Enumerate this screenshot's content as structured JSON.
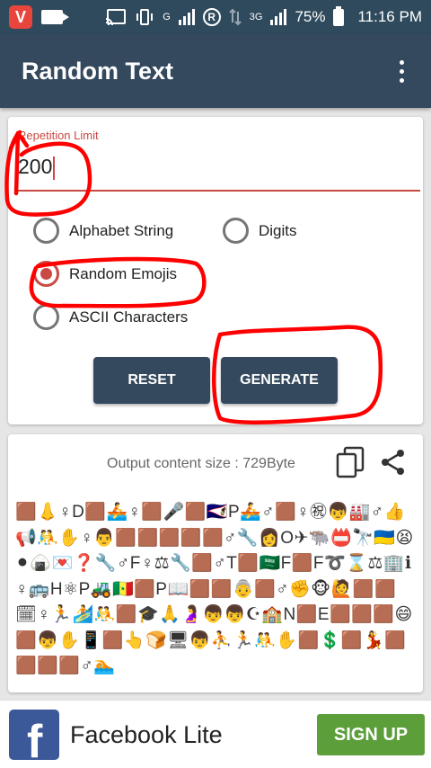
{
  "status_bar": {
    "app_badge": "V",
    "net_g": "G",
    "net_r": "R",
    "net_3g": "3G",
    "battery": "75%",
    "time": "11:16 PM"
  },
  "app_bar": {
    "title": "Random Text"
  },
  "form": {
    "label": "Repetition Limit",
    "value": "200",
    "options": [
      {
        "label": "Alphabet String",
        "checked": false
      },
      {
        "label": "Digits",
        "checked": false
      },
      {
        "label": "Random Emojis",
        "checked": true
      },
      {
        "label": "ASCII Characters",
        "checked": false
      }
    ],
    "reset_label": "RESET",
    "generate_label": "GENERATE"
  },
  "output": {
    "size_label": "Output content size : 729Byte",
    "content": "🟫👃♀D🟫🚣♀🟫🎤🟫🇦🇸P🚣♂🟫♀㊗👦🏭♂👍📢🤼✋♀👨🟫🟫🟫🟫🟫♂🔧👩O✈🐃📛🔭🇺🇦😫⚫🍙💌❓🔧♂F♀⚖🔧🟫♂T🟫🇸🇦F🟫F➰⌛⚖🏢ℹ♀🚌H⚛P🚜🇸🇳🟫P📖🟫🟫👵🟫♂✊🐵🙋🟫🟫🗓♀🏃🏄🤼🟫🎓🙏🤰👦👦☪🏫N🟫E🟫🟫🟫😄🟫👦✋📱🟫👆🍞🖥👦⛹🏃🤼✋🟫💲🟫💃🟫🟫🟫🟫♂🏊"
  },
  "ad": {
    "logo_letter": "f",
    "title": "Facebook Lite",
    "cta": "SIGN UP"
  },
  "colors": {
    "primary": "#34495e",
    "accent": "#c94a43",
    "ad_cta": "#5b9e3a",
    "annotation": "#ff0000"
  }
}
